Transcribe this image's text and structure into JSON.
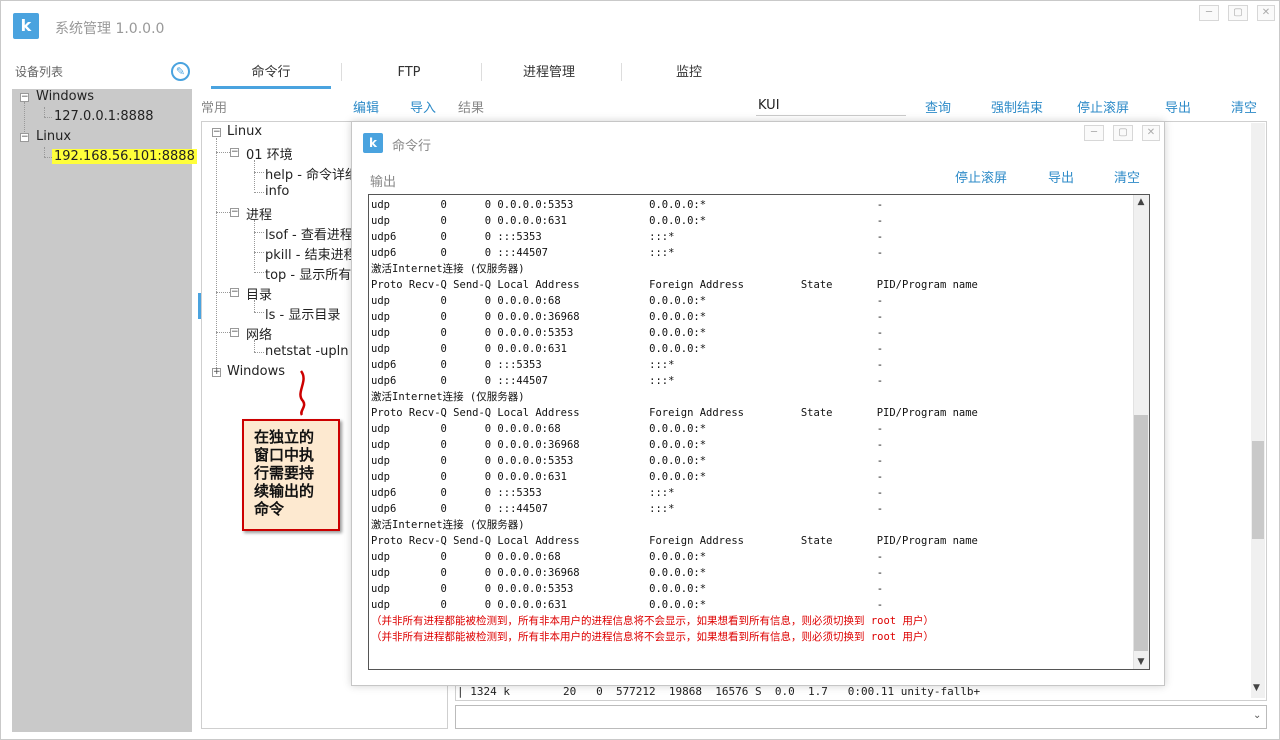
{
  "app": {
    "logo": "k",
    "title": "系统管理 1.0.0.0",
    "window_buttons": [
      "─",
      "▢",
      "✕"
    ]
  },
  "sidebar": {
    "label": "设备列表",
    "edit_icon": "compass-edit-icon",
    "tree": {
      "windows": "Windows",
      "windows_ip": "127.0.0.1:8888",
      "linux": "Linux",
      "linux_ip": "192.168.56.101:8888"
    }
  },
  "tabs": [
    "命令行",
    "FTP",
    "进程管理",
    "监控"
  ],
  "toolbar": {
    "common": "常用",
    "edit": "编辑",
    "import": "导入",
    "result": "结果",
    "search_value": "KUI",
    "query": "查询",
    "force_end": "强制结束",
    "stop_scroll": "停止滚屏",
    "export": "导出",
    "clear": "清空"
  },
  "cmdtree": {
    "linux": "Linux",
    "env": "01 环境",
    "help": "help - 命令详细",
    "info": "info",
    "process": "进程",
    "lsof": "lsof - 查看进程打",
    "pkill": "pkill - 结束进程",
    "top": "top - 显示所有进",
    "dir": "目录",
    "ls": "ls - 显示目录",
    "net": "网络",
    "netstat": "netstat -upln -c",
    "windows": "Windows"
  },
  "callout": {
    "text": "在独立的窗口中执行需要持续输出的命令"
  },
  "result_line": "| 1324 k        20   0  577212  19868  16576 S  0.0  1.7   0:00.11 unity-fallb+",
  "popup": {
    "logo": "k",
    "title": "命令行",
    "buttons": [
      "─",
      "▢",
      "✕"
    ],
    "output_label": "输出",
    "stop_scroll": "停止滚屏",
    "export": "导出",
    "clear": "清空",
    "lines": [
      {
        "t": "udp        0      0 0.0.0.0:5353            0.0.0.0:*                           -"
      },
      {
        "t": "udp        0      0 0.0.0.0:631             0.0.0.0:*                           -"
      },
      {
        "t": "udp6       0      0 :::5353                 :::*                                -"
      },
      {
        "t": "udp6       0      0 :::44507                :::*                                -"
      },
      {
        "t": "激活Internet连接 (仅服务器)"
      },
      {
        "t": "Proto Recv-Q Send-Q Local Address           Foreign Address         State       PID/Program name"
      },
      {
        "t": "udp        0      0 0.0.0.0:68              0.0.0.0:*                           -"
      },
      {
        "t": "udp        0      0 0.0.0.0:36968           0.0.0.0:*                           -"
      },
      {
        "t": "udp        0      0 0.0.0.0:5353            0.0.0.0:*                           -"
      },
      {
        "t": "udp        0      0 0.0.0.0:631             0.0.0.0:*                           -"
      },
      {
        "t": "udp6       0      0 :::5353                 :::*                                -"
      },
      {
        "t": "udp6       0      0 :::44507                :::*                                -"
      },
      {
        "t": "激活Internet连接 (仅服务器)"
      },
      {
        "t": "Proto Recv-Q Send-Q Local Address           Foreign Address         State       PID/Program name"
      },
      {
        "t": "udp        0      0 0.0.0.0:68              0.0.0.0:*                           -"
      },
      {
        "t": "udp        0      0 0.0.0.0:36968           0.0.0.0:*                           -"
      },
      {
        "t": "udp        0      0 0.0.0.0:5353            0.0.0.0:*                           -"
      },
      {
        "t": "udp        0      0 0.0.0.0:631             0.0.0.0:*                           -"
      },
      {
        "t": "udp6       0      0 :::5353                 :::*                                -"
      },
      {
        "t": "udp6       0      0 :::44507                :::*                                -"
      },
      {
        "t": "激活Internet连接 (仅服务器)"
      },
      {
        "t": "Proto Recv-Q Send-Q Local Address           Foreign Address         State       PID/Program name"
      },
      {
        "t": "udp        0      0 0.0.0.0:68              0.0.0.0:*                           -"
      },
      {
        "t": "udp        0      0 0.0.0.0:36968           0.0.0.0:*                           -"
      },
      {
        "t": "udp        0      0 0.0.0.0:5353            0.0.0.0:*                           -"
      },
      {
        "t": "udp        0      0 0.0.0.0:631             0.0.0.0:*                           -"
      },
      {
        "t": "（并非所有进程都能被检测到，所有非本用户的进程信息将不会显示，如果想看到所有信息，则必须切换到 root 用户）",
        "red": true
      },
      {
        "t": "（并非所有进程都能被检测到，所有非本用户的进程信息将不会显示，如果想看到所有信息，则必须切换到 root 用户）",
        "red": true
      }
    ]
  },
  "colors": {
    "accent": "#4aa3df",
    "link": "#2e8bc8",
    "highlight": "#ffff3a",
    "callout_bg": "#fde9d0",
    "callout_border": "#cc0000",
    "warning_text": "#dd0000"
  }
}
